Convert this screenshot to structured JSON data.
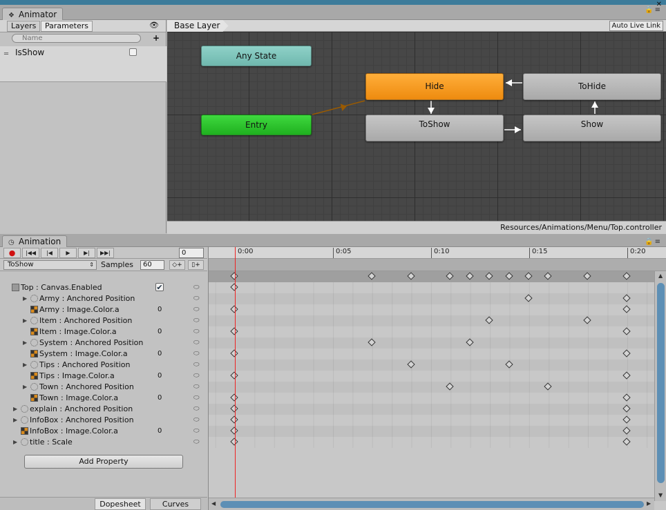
{
  "animator": {
    "tab_title": "Animator",
    "left_tabs": [
      "Layers",
      "Parameters"
    ],
    "search_placeholder": "Name",
    "parameters": [
      {
        "name": "IsShow",
        "value": false
      }
    ],
    "breadcrumb": "Base Layer",
    "auto_live_link": "Auto Live Link",
    "states": {
      "any_state": "Any State",
      "entry": "Entry",
      "hide": "Hide",
      "to_hide": "ToHide",
      "to_show": "ToShow",
      "show": "Show"
    },
    "controller_path": "Resources/Animations/Menu/Top.controller",
    "colors": {
      "entry": "#22b522",
      "any_state": "#7ec4ba",
      "selected": "#f29a1e",
      "grey": "#b0b0b0"
    }
  },
  "animation": {
    "tab_title": "Animation",
    "frame_value": "0",
    "clip_name": "ToShow",
    "samples_label": "Samples",
    "samples_value": "60",
    "ruler_labels": [
      "0:00",
      "0:05",
      "0:10",
      "0:15",
      "0:20"
    ],
    "properties": [
      {
        "label": "Top : Canvas.Enabled",
        "indent": 0,
        "expandable": false,
        "icon": "canvas",
        "checked": true
      },
      {
        "label": "Army : Anchored Position",
        "indent": 2,
        "expandable": true,
        "icon": "transform"
      },
      {
        "label": "Army : Image.Color.a",
        "indent": 2,
        "expandable": false,
        "icon": "color",
        "value": "0"
      },
      {
        "label": "Item : Anchored Position",
        "indent": 2,
        "expandable": true,
        "icon": "transform"
      },
      {
        "label": "Item : Image.Color.a",
        "indent": 2,
        "expandable": false,
        "icon": "color",
        "value": "0"
      },
      {
        "label": "System : Anchored Position",
        "indent": 2,
        "expandable": true,
        "icon": "transform"
      },
      {
        "label": "System : Image.Color.a",
        "indent": 2,
        "expandable": false,
        "icon": "color",
        "value": "0"
      },
      {
        "label": "Tips : Anchored Position",
        "indent": 2,
        "expandable": true,
        "icon": "transform"
      },
      {
        "label": "Tips : Image.Color.a",
        "indent": 2,
        "expandable": false,
        "icon": "color",
        "value": "0"
      },
      {
        "label": "Town : Anchored Position",
        "indent": 2,
        "expandable": true,
        "icon": "transform"
      },
      {
        "label": "Town : Image.Color.a",
        "indent": 2,
        "expandable": false,
        "icon": "color",
        "value": "0"
      },
      {
        "label": "explain : Anchored Position",
        "indent": 1,
        "expandable": true,
        "icon": "transform"
      },
      {
        "label": "InfoBox : Anchored Position",
        "indent": 1,
        "expandable": true,
        "icon": "transform"
      },
      {
        "label": "InfoBox : Image.Color.a",
        "indent": 1,
        "expandable": false,
        "icon": "color",
        "value": "0"
      },
      {
        "label": "title : Scale",
        "indent": 1,
        "expandable": true,
        "icon": "transform"
      }
    ],
    "add_property": "Add Property",
    "view_tabs": [
      "Dopesheet",
      "Curves"
    ],
    "summary_keys": [
      0,
      7,
      9,
      11,
      12,
      13,
      14,
      15,
      16,
      18,
      20
    ],
    "property_keys": [
      [
        0
      ],
      [
        15,
        20
      ],
      [
        0,
        20
      ],
      [
        13,
        18
      ],
      [
        0,
        20
      ],
      [
        7,
        12
      ],
      [
        0,
        20
      ],
      [
        9,
        14
      ],
      [
        0,
        20
      ],
      [
        11,
        16
      ],
      [
        0,
        20
      ],
      [
        0,
        20
      ],
      [
        0,
        20
      ],
      [
        0,
        20
      ],
      [
        0,
        20
      ]
    ]
  }
}
